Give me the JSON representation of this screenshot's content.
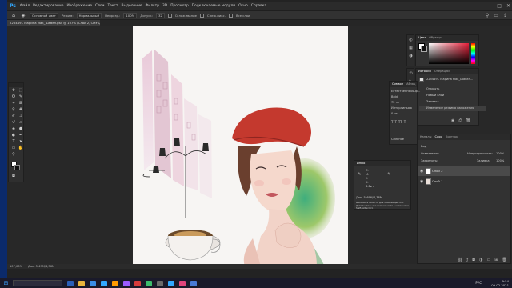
{
  "menubar": {
    "logo": "Ps",
    "items": [
      "Файл",
      "Редактирование",
      "Изображение",
      "Слои",
      "Текст",
      "Выделение",
      "Фильтр",
      "3D",
      "Просмотр",
      "Подключаемые модули",
      "Окно",
      "Справка"
    ],
    "window_controls": [
      "–",
      "□",
      "✕"
    ]
  },
  "options_bar": {
    "preset": "Основной цвет",
    "mode_label": "Режим:",
    "mode_value": "Нормальный",
    "opacity_label": "Непрозр.:",
    "opacity_value": "100%",
    "tolerance_label": "Допуск:",
    "tolerance_value": "32",
    "smoothing_label": "Сглаживание",
    "contiguous_label": "Смеж.пикс.",
    "all_layers_label": "Все слои"
  },
  "document_tab": {
    "title": "225449 - Марина Мак_Шавел.psd @ 107% (Слой 2, CMYK/8) *"
  },
  "color_panel": {
    "tabs": [
      "Цвет",
      "Образцы"
    ]
  },
  "history_panel": {
    "tabs": [
      "История",
      "Операции"
    ],
    "items": [
      {
        "label": "225449 - Марина Мак_Шавел..."
      },
      {
        "label": "Открыть"
      },
      {
        "label": "Новый слой"
      },
      {
        "label": "Заливка"
      },
      {
        "label": "Изменение режима наложения"
      }
    ]
  },
  "character_panel": {
    "tabs": [
      "Символ",
      "Абзац"
    ],
    "font": "ЕстественныйШр...",
    "style": "Bold",
    "size": "72 пт",
    "tracking": "Интерлиньяж",
    "scale": "0 пт",
    "antialias": "Сильное"
  },
  "info_panel": {
    "title": "Инфо",
    "c_label": "C:",
    "m_label": "M:",
    "y_label": "Y:",
    "k_label": "K:",
    "bit_depth": "8-бит",
    "doc_size": "Док: 5,49М/4,36М",
    "hint": "Щелкните области для заливки цветом. Дополнительные возможности с клавишами Shift, Alt и Ctrl."
  },
  "layers_panel": {
    "tabs": [
      "Каналы",
      "Слои",
      "Контуры"
    ],
    "kind_label": "Вид",
    "blend_mode": "Осветление",
    "opacity_label": "Непрозрачность:",
    "opacity_value": "100%",
    "lock_label": "Закрепить:",
    "fill_label": "Заливка:",
    "fill_value": "100%",
    "layers": [
      {
        "name": "Слой 2",
        "selected": true
      },
      {
        "name": "Слой 1",
        "selected": false
      }
    ]
  },
  "status_bar": {
    "zoom": "107,08%",
    "doc": "Док: 5,49М/4,36М"
  },
  "taskbar": {
    "language": "РУС",
    "time": "9:54",
    "date": "09.02.2021"
  }
}
